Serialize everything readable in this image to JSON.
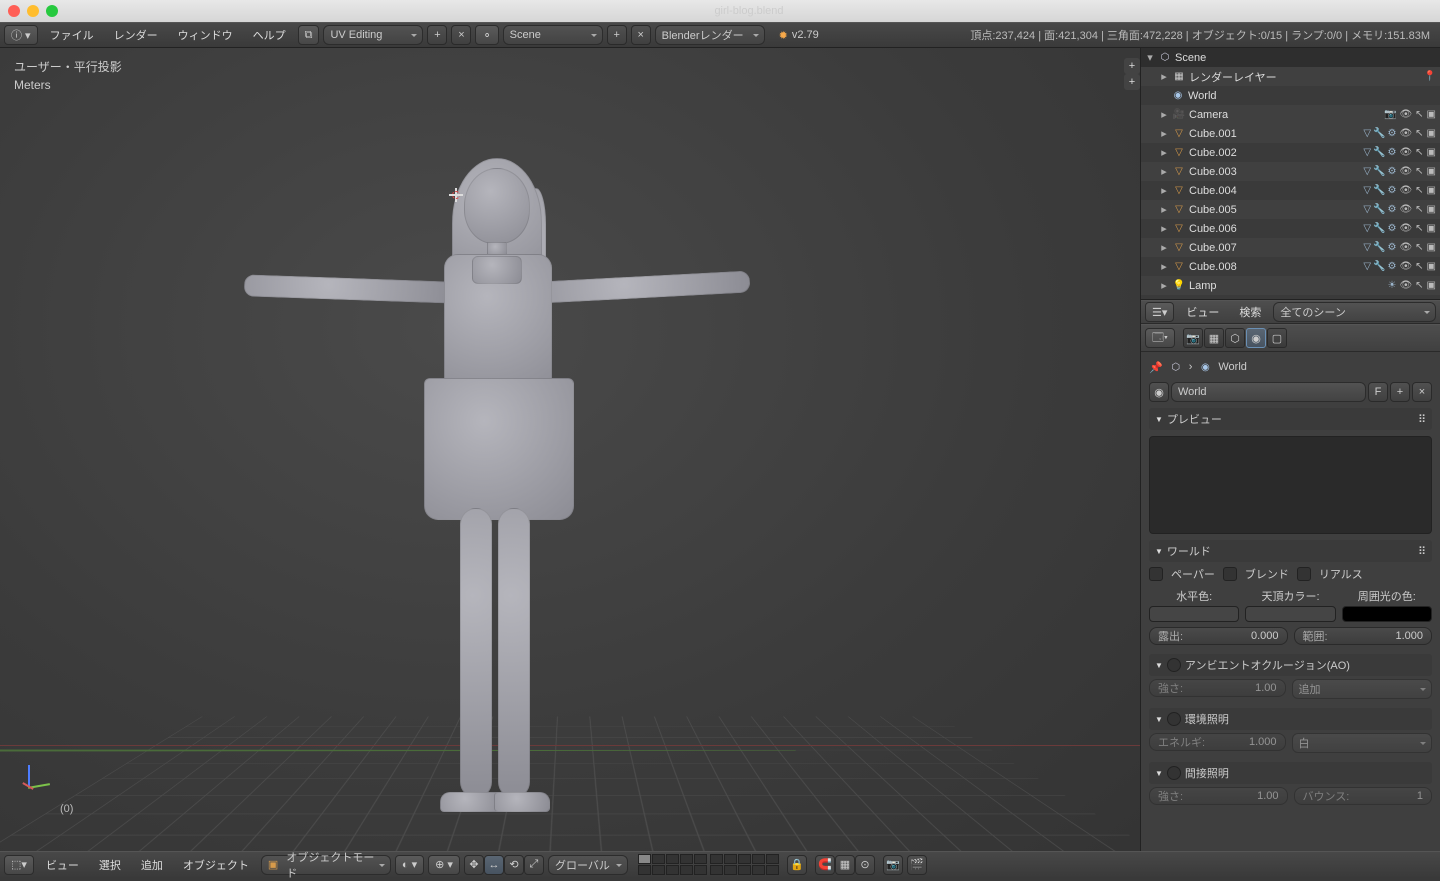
{
  "title": "girl-blog.blend",
  "top_menus": [
    "ファイル",
    "レンダー",
    "ウィンドウ",
    "ヘルプ"
  ],
  "layout_selector": "UV Editing",
  "scene_selector": "Scene",
  "engine_selector": "Blenderレンダー",
  "version": "v2.79",
  "stats": "頂点:237,424 | 面:421,304 | 三角面:472,228 | オブジェクト:0/15 | ランプ:0/0 | メモリ:151.83M",
  "viewport": {
    "label_top": "ユーザー・平行投影",
    "label_sub": "Meters",
    "count": "(0)"
  },
  "outliner": {
    "scene": "Scene",
    "render_layers": "レンダーレイヤー",
    "world": "World",
    "camera": "Camera",
    "objects": [
      "Cube.001",
      "Cube.002",
      "Cube.003",
      "Cube.004",
      "Cube.005",
      "Cube.006",
      "Cube.007",
      "Cube.008"
    ],
    "lamp": "Lamp"
  },
  "outliner_head": {
    "view": "ビュー",
    "search": "検索",
    "filter": "全てのシーン"
  },
  "properties": {
    "breadcrumb": "World",
    "id_field": "World",
    "f": "F",
    "panels": {
      "preview": "プレビュー",
      "world": "ワールド",
      "ao": "アンビエントオクルージョン(AO)",
      "env": "環境照明",
      "indirect": "間接照明"
    },
    "world_checks": {
      "paper": "ペーパー",
      "blend": "ブレンド",
      "real": "リアルス"
    },
    "world_colors": {
      "horizon": "水平色:",
      "zenith": "天頂カラー:",
      "ambient": "周囲光の色:"
    },
    "swatches": {
      "horizon": "#454545",
      "zenith": "#454545",
      "ambient": "#000000"
    },
    "exposure": {
      "label": "露出:",
      "val": "0.000"
    },
    "range": {
      "label": "範囲:",
      "val": "1.000"
    },
    "ao_strength": {
      "label": "強さ:",
      "val": "1.00"
    },
    "ao_mode": "追加",
    "env_energy": {
      "label": "エネルギ:",
      "val": "1.000"
    },
    "env_color": "白",
    "indirect_strength": {
      "label": "強さ:",
      "val": "1.00"
    },
    "indirect_bounce": {
      "label": "バウンス:",
      "val": "1"
    }
  },
  "footer": {
    "menus": [
      "ビュー",
      "選択",
      "追加",
      "オブジェクト"
    ],
    "mode": "オブジェクトモード",
    "orientation": "グローバル"
  }
}
